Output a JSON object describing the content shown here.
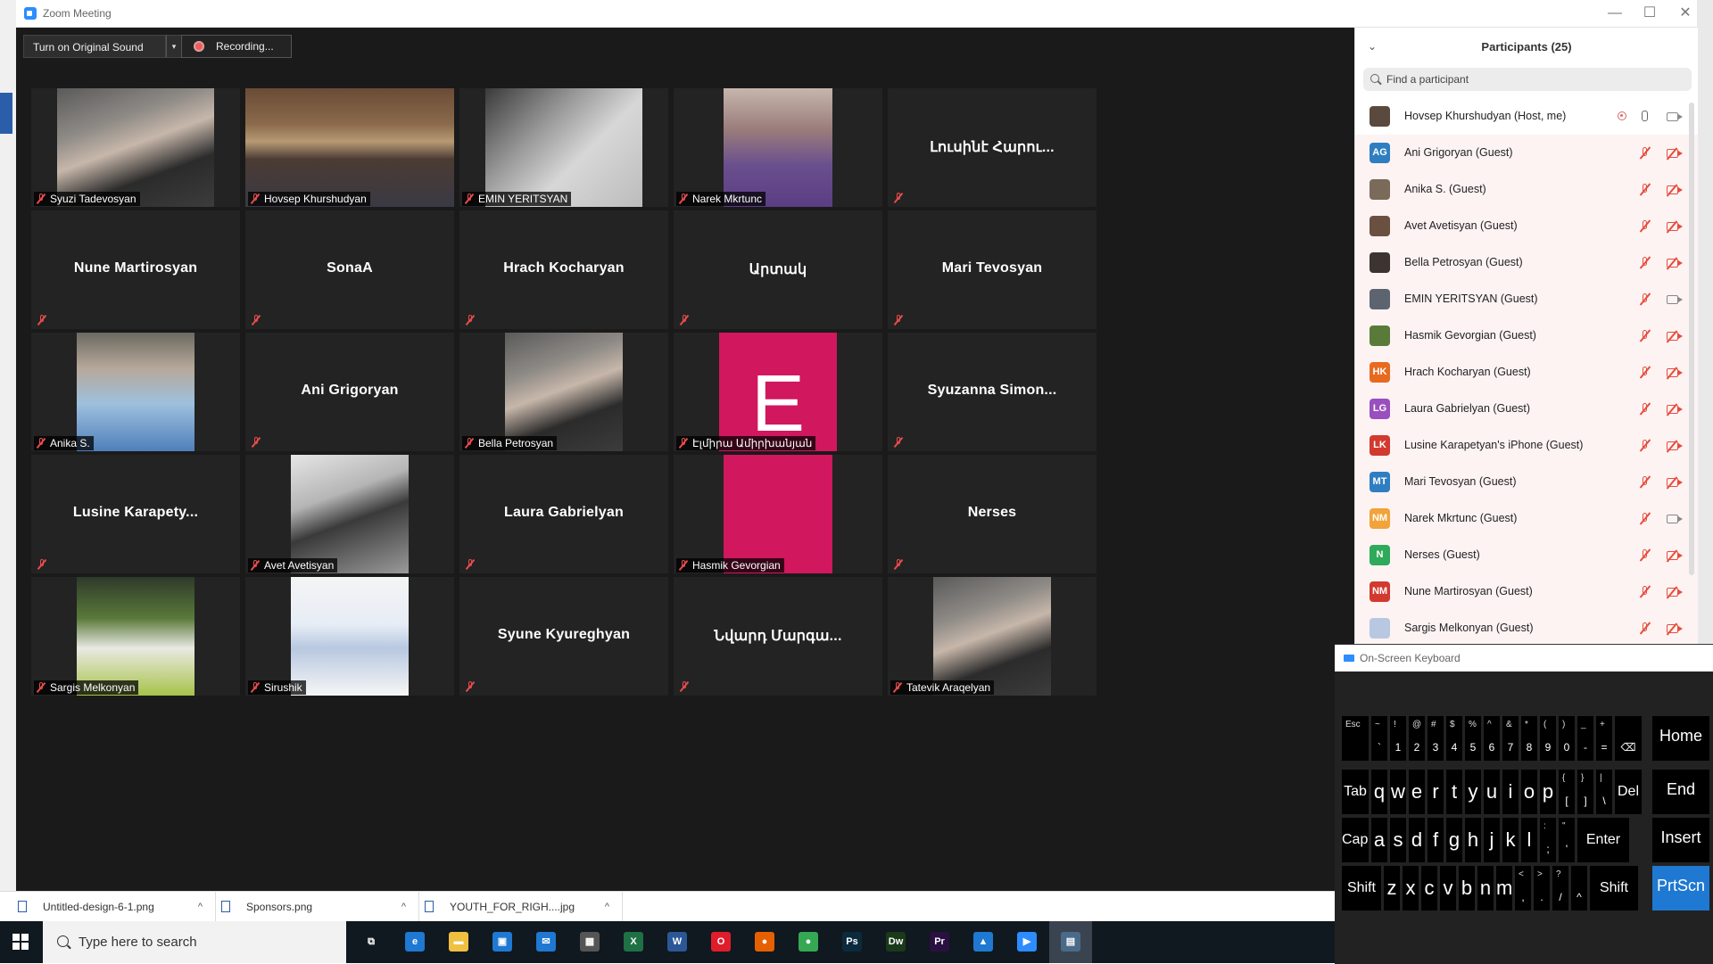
{
  "window": {
    "title": "Zoom Meeting",
    "minimize": "—",
    "maximize": "☐",
    "close": "✕"
  },
  "controls": {
    "original_sound": "Turn on Original Sound",
    "original_sound_dropdown": "▾",
    "recording": "Recording..."
  },
  "tiles": [
    {
      "name": "Syuzi Tadevosyan",
      "video": true
    },
    {
      "name": "Hovsep Khurshudyan",
      "video": true,
      "active": true
    },
    {
      "name": "EMIN YERITSYAN",
      "video": true
    },
    {
      "name": "Narek Mkrtunc",
      "video": true
    },
    {
      "name": "Լուսինէ Հարու...",
      "video": false
    },
    {
      "name": "Nune Martirosyan",
      "video": false
    },
    {
      "name": "SonaA",
      "video": false
    },
    {
      "name": "Hrach Kocharyan",
      "video": false
    },
    {
      "name": "Արտակ",
      "video": false
    },
    {
      "name": "Mari Tevosyan",
      "video": false
    },
    {
      "name": "Anika S.",
      "video": true
    },
    {
      "name": "Ani Grigoryan",
      "video": false
    },
    {
      "name": "Bella Petrosyan",
      "video": true
    },
    {
      "name": "Էլմիրա Ամիրխանյան",
      "video": true,
      "letter": "E"
    },
    {
      "name": "Syuzanna Simon...",
      "video": false
    },
    {
      "name": "Lusine Karapety...",
      "video": false
    },
    {
      "name": "Avet Avetisyan",
      "video": true
    },
    {
      "name": "Laura Gabrielyan",
      "video": false
    },
    {
      "name": "Hasmik Gevorgian",
      "video": true
    },
    {
      "name": "Nerses",
      "video": false
    },
    {
      "name": "Sargis Melkonyan",
      "video": true
    },
    {
      "name": "Sirushik",
      "video": true
    },
    {
      "name": "Syune Kyureghyan",
      "video": false
    },
    {
      "name": "Նվարդ Մարգա...",
      "video": false
    },
    {
      "name": "Tatevik Araqelyan",
      "video": true
    }
  ],
  "participants": {
    "collapse": "⌄",
    "title": "Participants (25)",
    "search_placeholder": "Find a participant",
    "list": [
      {
        "name": "Hovsep Khurshudyan (Host, me)",
        "initials": "",
        "color": "#5a4a3e",
        "host": true
      },
      {
        "name": "Ani Grigoryan (Guest)",
        "initials": "AG",
        "color": "#2f7ec1"
      },
      {
        "name": "Anika S. (Guest)",
        "initials": "",
        "color": "#7a6a5a"
      },
      {
        "name": "Avet Avetisyan (Guest)",
        "initials": "",
        "color": "#6a5040"
      },
      {
        "name": "Bella Petrosyan (Guest)",
        "initials": "",
        "color": "#3c3430"
      },
      {
        "name": "EMIN YERITSYAN (Guest)",
        "initials": "",
        "color": "#5c6470",
        "cam_on": true
      },
      {
        "name": "Hasmik Gevorgian (Guest)",
        "initials": "",
        "color": "#5a7a3a"
      },
      {
        "name": "Hrach Kocharyan (Guest)",
        "initials": "HK",
        "color": "#e86a1f"
      },
      {
        "name": "Laura Gabrielyan (Guest)",
        "initials": "LG",
        "color": "#9a4fbf"
      },
      {
        "name": "Lusine Karapetyan's iPhone (Guest)",
        "initials": "LK",
        "color": "#d23a2f"
      },
      {
        "name": "Mari Tevosyan (Guest)",
        "initials": "MT",
        "color": "#2f7ec1"
      },
      {
        "name": "Narek Mkrtunc (Guest)",
        "initials": "NM",
        "color": "#f2a33a",
        "cam_on": true
      },
      {
        "name": "Nerses (Guest)",
        "initials": "N",
        "color": "#2faa5a"
      },
      {
        "name": "Nune Martirosyan (Guest)",
        "initials": "NM",
        "color": "#d23a2f"
      },
      {
        "name": "Sargis Melkonyan (Guest)",
        "initials": "",
        "color": "#b8c8e0"
      }
    ]
  },
  "osk": {
    "title": "On-Screen Keyboard",
    "rows": [
      [
        {
          "m": "",
          "s": "Esc"
        },
        {
          "m": "`",
          "s": "~"
        },
        {
          "m": "1",
          "s": "!"
        },
        {
          "m": "2",
          "s": "@"
        },
        {
          "m": "3",
          "s": "#"
        },
        {
          "m": "4",
          "s": "$"
        },
        {
          "m": "5",
          "s": "%"
        },
        {
          "m": "6",
          "s": "^"
        },
        {
          "m": "7",
          "s": "&"
        },
        {
          "m": "8",
          "s": "*"
        },
        {
          "m": "9",
          "s": "("
        },
        {
          "m": "0",
          "s": ")"
        },
        {
          "m": "-",
          "s": "_"
        },
        {
          "m": "=",
          "s": "+"
        },
        {
          "m": "⌫",
          "s": ""
        }
      ],
      [
        {
          "m": "Tab",
          "s": ""
        },
        {
          "m": "q",
          "s": ""
        },
        {
          "m": "w",
          "s": ""
        },
        {
          "m": "e",
          "s": ""
        },
        {
          "m": "r",
          "s": ""
        },
        {
          "m": "t",
          "s": ""
        },
        {
          "m": "y",
          "s": ""
        },
        {
          "m": "u",
          "s": ""
        },
        {
          "m": "i",
          "s": ""
        },
        {
          "m": "o",
          "s": ""
        },
        {
          "m": "p",
          "s": ""
        },
        {
          "m": "[",
          "s": "{"
        },
        {
          "m": "]",
          "s": "}"
        },
        {
          "m": "\\",
          "s": "|"
        },
        {
          "m": "Del",
          "s": ""
        }
      ],
      [
        {
          "m": "Caps",
          "s": ""
        },
        {
          "m": "a",
          "s": ""
        },
        {
          "m": "s",
          "s": ""
        },
        {
          "m": "d",
          "s": ""
        },
        {
          "m": "f",
          "s": ""
        },
        {
          "m": "g",
          "s": ""
        },
        {
          "m": "h",
          "s": ""
        },
        {
          "m": "j",
          "s": ""
        },
        {
          "m": "k",
          "s": ""
        },
        {
          "m": "l",
          "s": ""
        },
        {
          "m": ";",
          "s": ":"
        },
        {
          "m": "'",
          "s": "\""
        },
        {
          "m": "Enter",
          "s": ""
        }
      ],
      [
        {
          "m": "Shift",
          "s": ""
        },
        {
          "m": "z",
          "s": ""
        },
        {
          "m": "x",
          "s": ""
        },
        {
          "m": "c",
          "s": ""
        },
        {
          "m": "v",
          "s": ""
        },
        {
          "m": "b",
          "s": ""
        },
        {
          "m": "n",
          "s": ""
        },
        {
          "m": "m",
          "s": ""
        },
        {
          "m": ",",
          "s": "<"
        },
        {
          "m": ".",
          "s": ">"
        },
        {
          "m": "/",
          "s": "?"
        },
        {
          "m": "^",
          "s": ""
        },
        {
          "m": "Shift",
          "s": ""
        }
      ]
    ],
    "side_keys": [
      "Home",
      "End",
      "Insert",
      "PrtScn"
    ]
  },
  "downloads": [
    {
      "name": "Untitled-design-6-1.png",
      "chev": "^"
    },
    {
      "name": "Sponsors.png",
      "chev": "^"
    },
    {
      "name": "YOUTH_FOR_RIGH....jpg",
      "chev": "^"
    }
  ],
  "taskbar": {
    "search_placeholder": "Type here to search",
    "apps": [
      {
        "name": "task-view",
        "label": "⧉",
        "color": "transparent"
      },
      {
        "name": "edge",
        "label": "e",
        "color": "#1f78d1"
      },
      {
        "name": "file-explorer",
        "label": "▬",
        "color": "#f0c040"
      },
      {
        "name": "store",
        "label": "▣",
        "color": "#1f78d1"
      },
      {
        "name": "mail",
        "label": "✉",
        "color": "#1f78d1"
      },
      {
        "name": "calculator",
        "label": "▦",
        "color": "#555555"
      },
      {
        "name": "excel",
        "label": "X",
        "color": "#1e7145"
      },
      {
        "name": "word",
        "label": "W",
        "color": "#2b5797"
      },
      {
        "name": "opera",
        "label": "O",
        "color": "#e01e2b"
      },
      {
        "name": "firefox",
        "label": "●",
        "color": "#e66000"
      },
      {
        "name": "chrome",
        "label": "●",
        "color": "#34a853"
      },
      {
        "name": "photoshop",
        "label": "Ps",
        "color": "#0b2a3c"
      },
      {
        "name": "dreamweaver",
        "label": "Dw",
        "color": "#1a3a1a"
      },
      {
        "name": "premiere",
        "label": "Pr",
        "color": "#2a1040"
      },
      {
        "name": "photos",
        "label": "▲",
        "color": "#1f78d1"
      },
      {
        "name": "zoom",
        "label": "▶",
        "color": "#2d8cff"
      },
      {
        "name": "remote-desktop",
        "label": "▤",
        "color": "#4a6a8a"
      }
    ]
  }
}
